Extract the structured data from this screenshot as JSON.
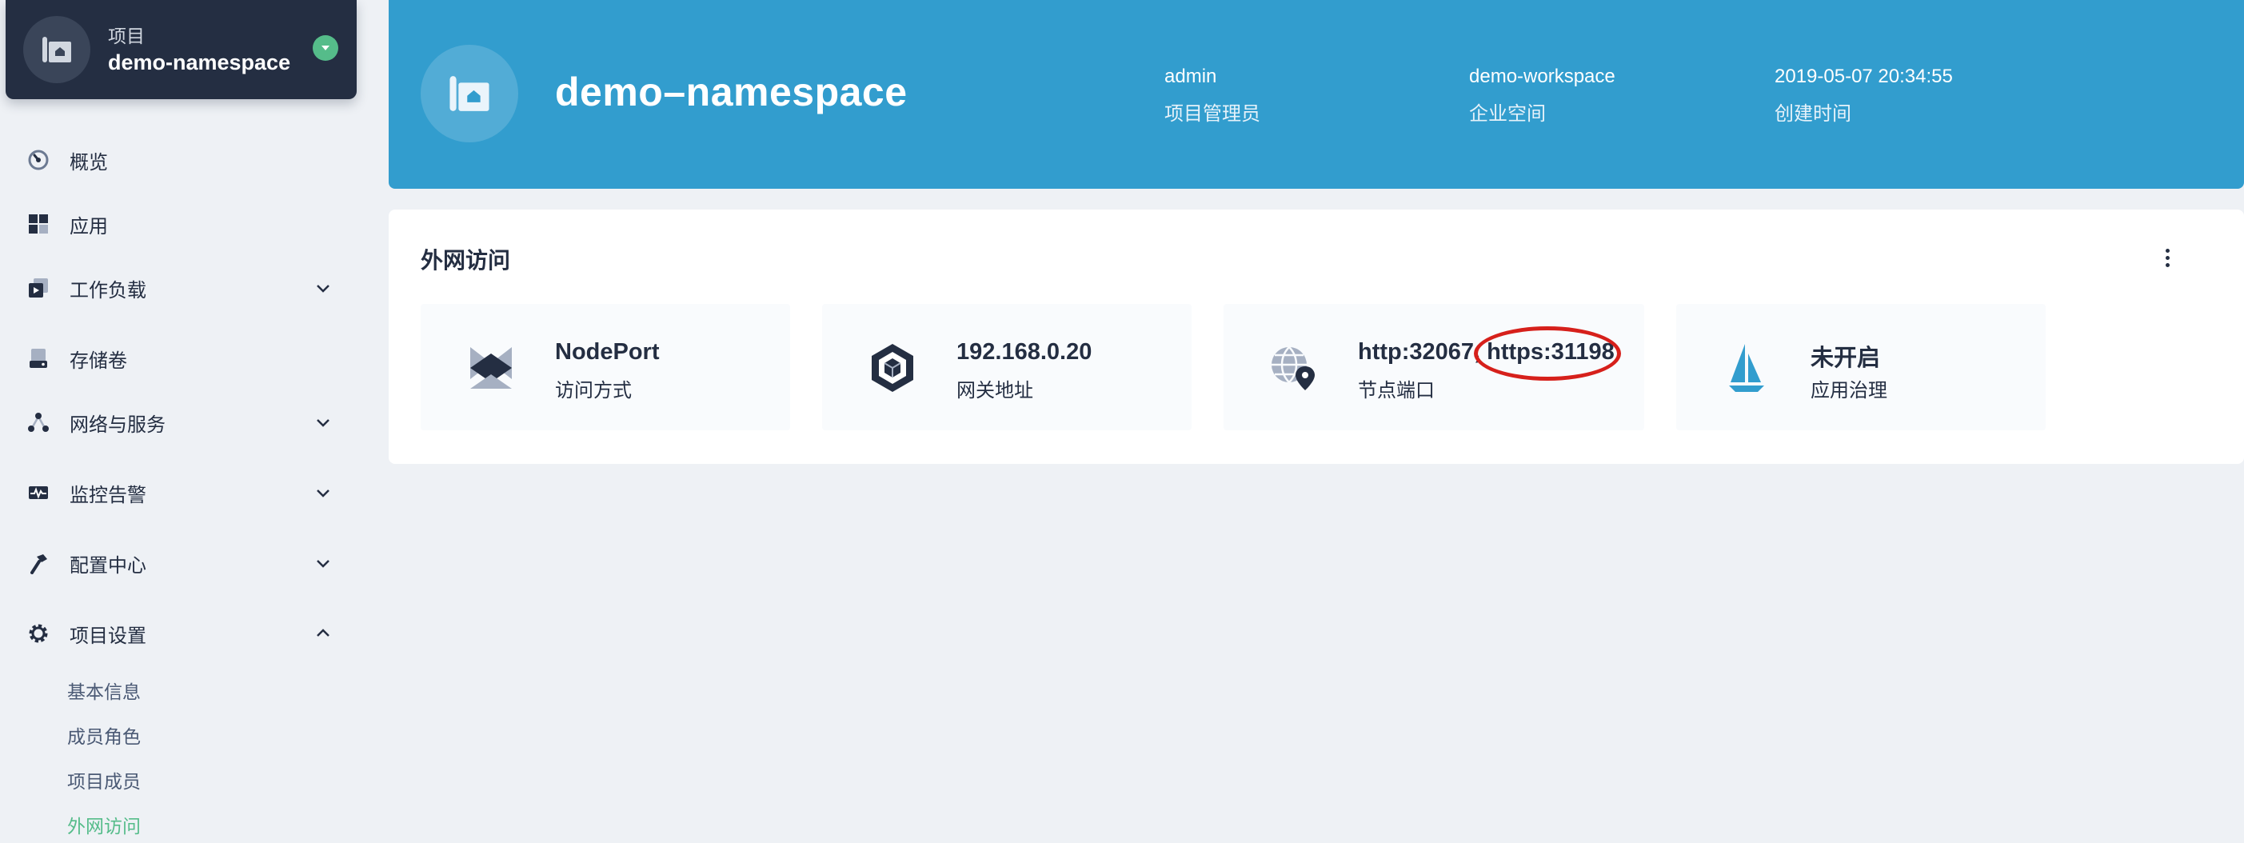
{
  "sidebar": {
    "project_label": "项目",
    "project_name": "demo-namespace",
    "nav": [
      {
        "label": "概览",
        "icon": "dashboard-icon"
      },
      {
        "label": "应用",
        "icon": "apps-icon"
      },
      {
        "label": "工作负载",
        "icon": "workload-icon"
      },
      {
        "label": "存储卷",
        "icon": "storage-icon"
      },
      {
        "label": "网络与服务",
        "icon": "network-icon"
      },
      {
        "label": "监控告警",
        "icon": "monitor-icon"
      },
      {
        "label": "配置中心",
        "icon": "hammer-icon"
      },
      {
        "label": "项目设置",
        "icon": "gear-icon"
      }
    ],
    "settings_sub": [
      {
        "label": "基本信息"
      },
      {
        "label": "成员角色"
      },
      {
        "label": "项目成员"
      },
      {
        "label": "外网访问",
        "active": true
      }
    ]
  },
  "banner": {
    "title": "demo–namespace",
    "meta": [
      {
        "value": "admin",
        "key": "项目管理员"
      },
      {
        "value": "demo-workspace",
        "key": "企业空间"
      },
      {
        "value": "2019-05-07 20:34:55",
        "key": "创建时间"
      }
    ]
  },
  "panel": {
    "title": "外网访问",
    "cards": [
      {
        "value": "NodePort",
        "label": "访问方式",
        "icon": "nodeport-icon"
      },
      {
        "value": "192.168.0.20",
        "label": "网关地址",
        "icon": "gateway-icon"
      },
      {
        "value": "http:32067, https:31198",
        "label": "节点端口",
        "icon": "globe-pin-icon"
      },
      {
        "value": "未开启",
        "label": "应用治理",
        "icon": "sail-icon"
      }
    ]
  },
  "colors": {
    "accent_green": "#55bc8a",
    "banner_blue": "#329dce",
    "dark": "#242e42",
    "annotation_red": "#d6201b"
  }
}
